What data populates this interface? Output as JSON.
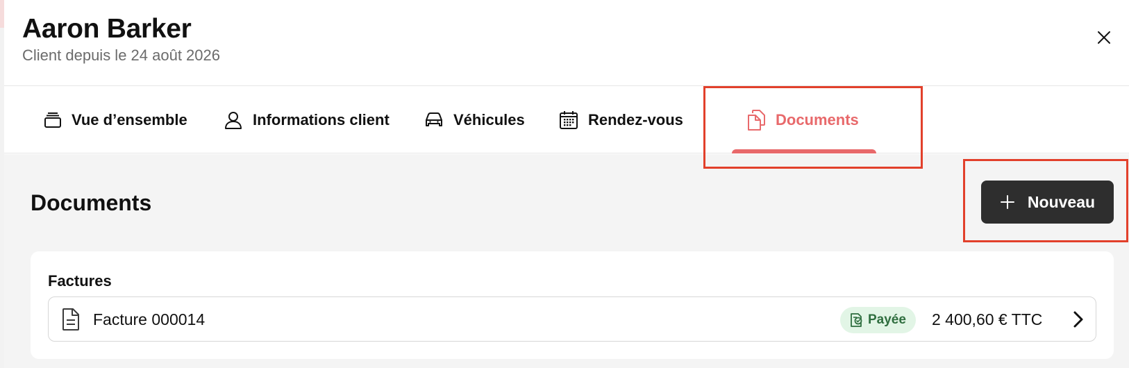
{
  "header": {
    "client_name": "Aaron Barker",
    "client_since": "Client depuis le 24 août 2026",
    "close_icon": "close-icon"
  },
  "tabs": [
    {
      "label": "Vue d’ensemble",
      "icon": "stack-icon",
      "active": false
    },
    {
      "label": "Informations client",
      "icon": "user-icon",
      "active": false
    },
    {
      "label": "Véhicules",
      "icon": "car-icon",
      "active": false
    },
    {
      "label": "Rendez-vous",
      "icon": "calendar-icon",
      "active": false
    },
    {
      "label": "Documents",
      "icon": "documents-icon",
      "active": true
    }
  ],
  "documents": {
    "title": "Documents",
    "new_button_label": "Nouveau",
    "sections": [
      {
        "title": "Factures",
        "items": [
          {
            "name": "Facture 000014",
            "status": "Payée",
            "amount": "2 400,60 € TTC"
          }
        ]
      }
    ]
  },
  "colors": {
    "accent": "#e8696b",
    "highlight": "#e2402b",
    "button_bg": "#2e2e2e",
    "badge_bg": "#e2f5e6",
    "badge_text": "#2f6e3f",
    "content_bg": "#f4f4f4"
  }
}
